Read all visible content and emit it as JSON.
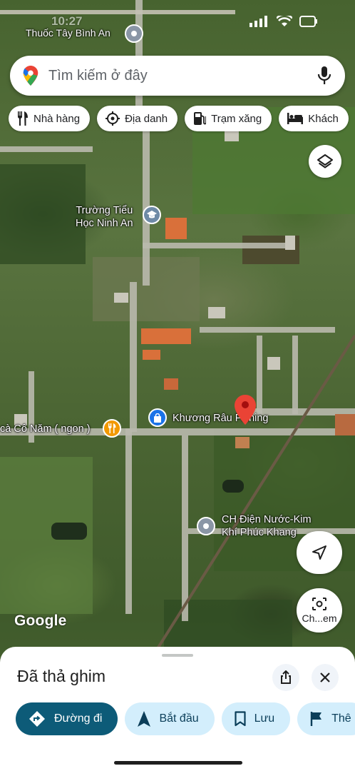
{
  "status_bar": {
    "time": "10:27"
  },
  "top_place": {
    "label": "Thuốc Tây Bình An"
  },
  "search": {
    "placeholder": "Tìm kiếm ở đây"
  },
  "chips": [
    {
      "label": "Nhà hàng",
      "icon": "fork-knife-icon"
    },
    {
      "label": "Địa danh",
      "icon": "landmark-icon"
    },
    {
      "label": "Trạm xăng",
      "icon": "gas-station-icon"
    },
    {
      "label": "Khách",
      "icon": "bed-icon"
    }
  ],
  "map_labels": {
    "school_line1": "Trường Tiểu",
    "school_line2": "Học Ninh An",
    "restaurant": "cà Cô Năm ( ngon )",
    "shop": "Khương Râu Fishing",
    "hardware_line1": "CH Điện Nước-Kim",
    "hardware_line2": "Khí Phúc Khang"
  },
  "map_buttons": {
    "lens_label": "Ch...em"
  },
  "google_logo": "Google",
  "sheet": {
    "title": "Đã thả ghim",
    "actions": [
      {
        "label": "Đường đi",
        "icon": "directions-icon"
      },
      {
        "label": "Bắt đầu",
        "icon": "navigation-arrow-icon"
      },
      {
        "label": "Lưu",
        "icon": "bookmark-icon"
      },
      {
        "label": "Thê",
        "icon": "flag-icon"
      }
    ]
  },
  "colors": {
    "primary_action": "#0d5b78",
    "secondary_action": "#d3eefc",
    "pin_red": "#ea4335",
    "poi_orange": "#f29900",
    "poi_blue": "#1a73e8"
  }
}
